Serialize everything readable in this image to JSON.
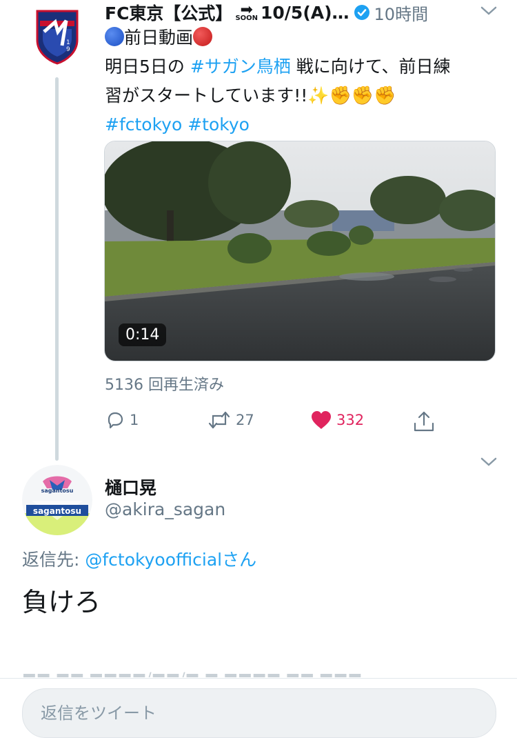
{
  "tweet": {
    "author_name": "FC東京【公式】",
    "soon_label": "SOON",
    "name_suffix": "10/5(A)…",
    "time": "10時間",
    "line1_text": "前日動画",
    "line2_prefix": "明日5日の ",
    "hashtag_sagan": "#サガン鳥栖",
    "line2_suffix": " 戦に向けて、前日練",
    "line3_text": "習がスタートしています!!",
    "hashtag_fctokyo": "#fctokyo",
    "hashtag_tokyo": "#tokyo",
    "video_duration": "0:14",
    "views": "5136 回再生済み",
    "reply_count": "1",
    "retweet_count": "27",
    "like_count": "332"
  },
  "reply": {
    "name": "樋口晃",
    "handle": "@akira_sagan",
    "reply_to_label": "返信先: ",
    "reply_to_mention": "@fctokyoofficialさん",
    "body": "負けろ"
  },
  "compose": {
    "placeholder": "返信をツイート"
  },
  "colors": {
    "accent": "#1da1f2",
    "like": "#e0245e",
    "muted": "#657786"
  }
}
